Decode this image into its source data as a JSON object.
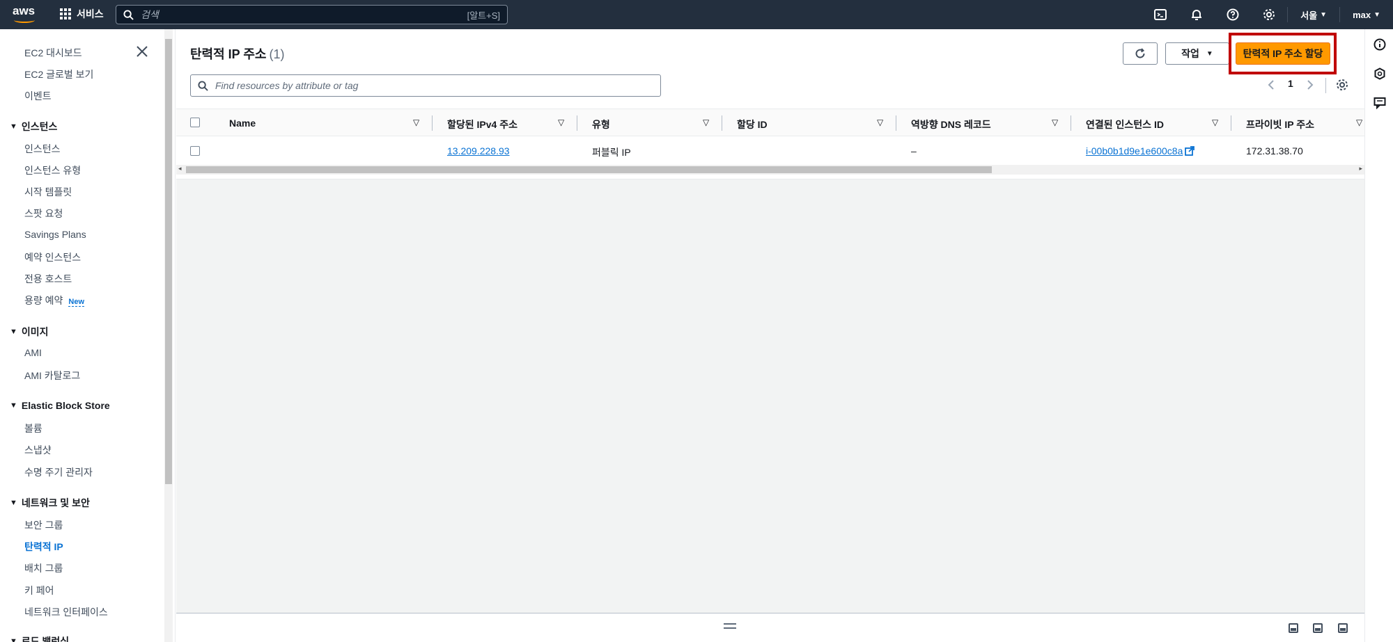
{
  "topbar": {
    "logo_text": "aws",
    "services_label": "서비스",
    "search_placeholder": "검색",
    "search_shortcut": "[알트+S]",
    "region_label": "서울",
    "user_label": "max"
  },
  "sidebar": {
    "items_top": [
      "EC2 대시보드",
      "EC2 글로벌 보기",
      "이벤트"
    ],
    "section_instances": "인스턴스",
    "instances_items": [
      "인스턴스",
      "인스턴스 유형",
      "시작 템플릿",
      "스팟 요청",
      "Savings Plans",
      "예약 인스턴스",
      "전용 호스트",
      "용량 예약"
    ],
    "new_badge": "New",
    "section_images": "이미지",
    "images_items": [
      "AMI",
      "AMI 카탈로그"
    ],
    "section_ebs": "Elastic Block Store",
    "ebs_items": [
      "볼륨",
      "스냅샷",
      "수명 주기 관리자"
    ],
    "section_network": "네트워크 및 보안",
    "network_items": [
      "보안 그룹",
      "탄력적 IP",
      "배치 그룹",
      "키 페어",
      "네트워크 인터페이스"
    ],
    "section_lb": "로드 밸런싱"
  },
  "main": {
    "title": "탄력적 IP 주소",
    "count": "(1)",
    "actions_label": "작업",
    "allocate_label": "탄력적 IP 주소 할당",
    "filter_placeholder": "Find resources by attribute or tag",
    "page_number": "1",
    "columns": [
      "Name",
      "할당된 IPv4 주소",
      "유형",
      "할당 ID",
      "역방향 DNS 레코드",
      "연결된 인스턴스 ID",
      "프라이빗 IP 주소"
    ],
    "rows": [
      {
        "name": "",
        "ipv4": "13.209.228.93",
        "type": "퍼블릭 IP",
        "allocation_id": "",
        "reverse_dns": "–",
        "instance_id": "i-00b0b1d9e1e600c8a",
        "private_ip": "172.31.38.70"
      }
    ]
  },
  "colors": {
    "topbar_bg": "#232f3e",
    "primary_button": "#ff9900",
    "link": "#0972d3",
    "highlight_box": "#c00000"
  }
}
